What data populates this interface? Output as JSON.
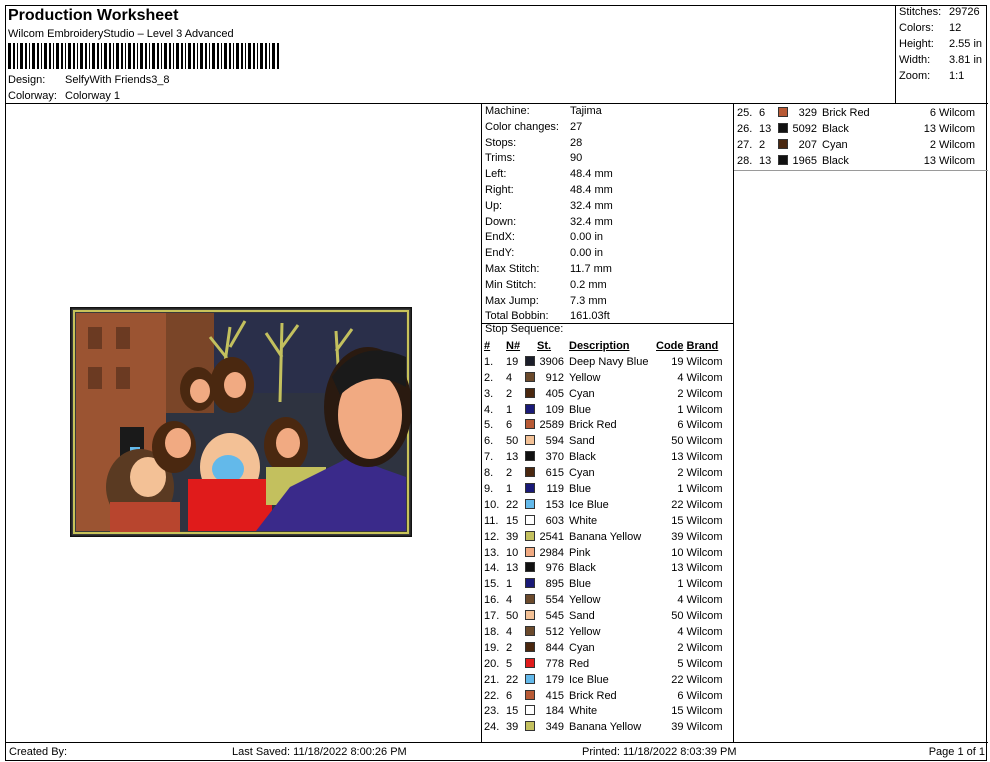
{
  "header": {
    "title": "Production Worksheet",
    "subtitle": "Wilcom EmbroideryStudio – Level 3 Advanced",
    "design_label": "Design:",
    "design_value": "SelfyWith Friends3_8",
    "colorway_label": "Colorway:",
    "colorway_value": "Colorway 1"
  },
  "stats": {
    "stitches_label": "Stitches:",
    "stitches_value": "29726",
    "colors_label": "Colors:",
    "colors_value": "12",
    "height_label": "Height:",
    "height_value": "2.55 in",
    "width_label": "Width:",
    "width_value": "3.81 in",
    "zoom_label": "Zoom:",
    "zoom_value": "1:1"
  },
  "machine": [
    {
      "label": "Machine:",
      "value": "Tajima"
    },
    {
      "label": "Color changes:",
      "value": "27"
    },
    {
      "label": "Stops:",
      "value": "28"
    },
    {
      "label": "Trims:",
      "value": "90"
    },
    {
      "label": "Left:",
      "value": "48.4 mm"
    },
    {
      "label": "Right:",
      "value": "48.4 mm"
    },
    {
      "label": "Up:",
      "value": "32.4 mm"
    },
    {
      "label": "Down:",
      "value": "32.4 mm"
    },
    {
      "label": "EndX:",
      "value": "0.00 in"
    },
    {
      "label": "EndY:",
      "value": "0.00 in"
    },
    {
      "label": "Max Stitch:",
      "value": "11.7 mm"
    },
    {
      "label": "Min Stitch:",
      "value": "0.2 mm"
    },
    {
      "label": "Max Jump:",
      "value": "7.3 mm"
    },
    {
      "label": "Total Bobbin:",
      "value": "161.03ft"
    }
  ],
  "stop_sequence": {
    "heading": "Stop Sequence:",
    "columns": {
      "num": "#",
      "n": "N#",
      "st": "St.",
      "description": "Description",
      "code": "Code",
      "brand": "Brand"
    },
    "rows": [
      {
        "num": "1.",
        "n": "19",
        "color": "#1b1e2a",
        "st": "3906",
        "description": "Deep Navy Blue",
        "code": "19",
        "brand": "Wilcom"
      },
      {
        "num": "2.",
        "n": "4",
        "color": "#6b4a2c",
        "st": "912",
        "description": "Yellow",
        "code": "4",
        "brand": "Wilcom"
      },
      {
        "num": "3.",
        "n": "2",
        "color": "#4a2810",
        "st": "405",
        "description": "Cyan",
        "code": "2",
        "brand": "Wilcom"
      },
      {
        "num": "4.",
        "n": "1",
        "color": "#1a1a78",
        "st": "109",
        "description": "Blue",
        "code": "1",
        "brand": "Wilcom"
      },
      {
        "num": "5.",
        "n": "6",
        "color": "#b85a35",
        "st": "2589",
        "description": "Brick Red",
        "code": "6",
        "brand": "Wilcom"
      },
      {
        "num": "6.",
        "n": "50",
        "color": "#f3c196",
        "st": "594",
        "description": "Sand",
        "code": "50",
        "brand": "Wilcom"
      },
      {
        "num": "7.",
        "n": "13",
        "color": "#111111",
        "st": "370",
        "description": "Black",
        "code": "13",
        "brand": "Wilcom"
      },
      {
        "num": "8.",
        "n": "2",
        "color": "#4a2810",
        "st": "615",
        "description": "Cyan",
        "code": "2",
        "brand": "Wilcom"
      },
      {
        "num": "9.",
        "n": "1",
        "color": "#1a1a78",
        "st": "119",
        "description": "Blue",
        "code": "1",
        "brand": "Wilcom"
      },
      {
        "num": "10.",
        "n": "22",
        "color": "#63b9ea",
        "st": "153",
        "description": "Ice Blue",
        "code": "22",
        "brand": "Wilcom"
      },
      {
        "num": "11.",
        "n": "15",
        "color": "#ffffff",
        "st": "603",
        "description": "White",
        "code": "15",
        "brand": "Wilcom"
      },
      {
        "num": "12.",
        "n": "39",
        "color": "#c3c05e",
        "st": "2541",
        "description": "Banana Yellow",
        "code": "39",
        "brand": "Wilcom"
      },
      {
        "num": "13.",
        "n": "10",
        "color": "#f1aa82",
        "st": "2984",
        "description": "Pink",
        "code": "10",
        "brand": "Wilcom"
      },
      {
        "num": "14.",
        "n": "13",
        "color": "#111111",
        "st": "976",
        "description": "Black",
        "code": "13",
        "brand": "Wilcom"
      },
      {
        "num": "15.",
        "n": "1",
        "color": "#1a1a78",
        "st": "895",
        "description": "Blue",
        "code": "1",
        "brand": "Wilcom"
      },
      {
        "num": "16.",
        "n": "4",
        "color": "#6b4a2c",
        "st": "554",
        "description": "Yellow",
        "code": "4",
        "brand": "Wilcom"
      },
      {
        "num": "17.",
        "n": "50",
        "color": "#f3c196",
        "st": "545",
        "description": "Sand",
        "code": "50",
        "brand": "Wilcom"
      },
      {
        "num": "18.",
        "n": "4",
        "color": "#6b4a2c",
        "st": "512",
        "description": "Yellow",
        "code": "4",
        "brand": "Wilcom"
      },
      {
        "num": "19.",
        "n": "2",
        "color": "#4a2810",
        "st": "844",
        "description": "Cyan",
        "code": "2",
        "brand": "Wilcom"
      },
      {
        "num": "20.",
        "n": "5",
        "color": "#e01b1b",
        "st": "778",
        "description": "Red",
        "code": "5",
        "brand": "Wilcom"
      },
      {
        "num": "21.",
        "n": "22",
        "color": "#63b9ea",
        "st": "179",
        "description": "Ice Blue",
        "code": "22",
        "brand": "Wilcom"
      },
      {
        "num": "22.",
        "n": "6",
        "color": "#b85a35",
        "st": "415",
        "description": "Brick Red",
        "code": "6",
        "brand": "Wilcom"
      },
      {
        "num": "23.",
        "n": "15",
        "color": "#ffffff",
        "st": "184",
        "description": "White",
        "code": "15",
        "brand": "Wilcom"
      },
      {
        "num": "24.",
        "n": "39",
        "color": "#c3c05e",
        "st": "349",
        "description": "Banana Yellow",
        "code": "39",
        "brand": "Wilcom"
      }
    ],
    "rows_right": [
      {
        "num": "25.",
        "n": "6",
        "color": "#b85a35",
        "st": "329",
        "description": "Brick Red",
        "code": "6",
        "brand": "Wilcom"
      },
      {
        "num": "26.",
        "n": "13",
        "color": "#111111",
        "st": "5092",
        "description": "Black",
        "code": "13",
        "brand": "Wilcom"
      },
      {
        "num": "27.",
        "n": "2",
        "color": "#4a2810",
        "st": "207",
        "description": "Cyan",
        "code": "2",
        "brand": "Wilcom"
      },
      {
        "num": "28.",
        "n": "13",
        "color": "#111111",
        "st": "1965",
        "description": "Black",
        "code": "13",
        "brand": "Wilcom"
      }
    ]
  },
  "footer": {
    "created_by": "Created By:",
    "last_saved": "Last Saved: 11/18/2022 8:00:26 PM",
    "printed": "Printed: 11/18/2022 8:03:39 PM",
    "page": "Page 1 of 1"
  }
}
